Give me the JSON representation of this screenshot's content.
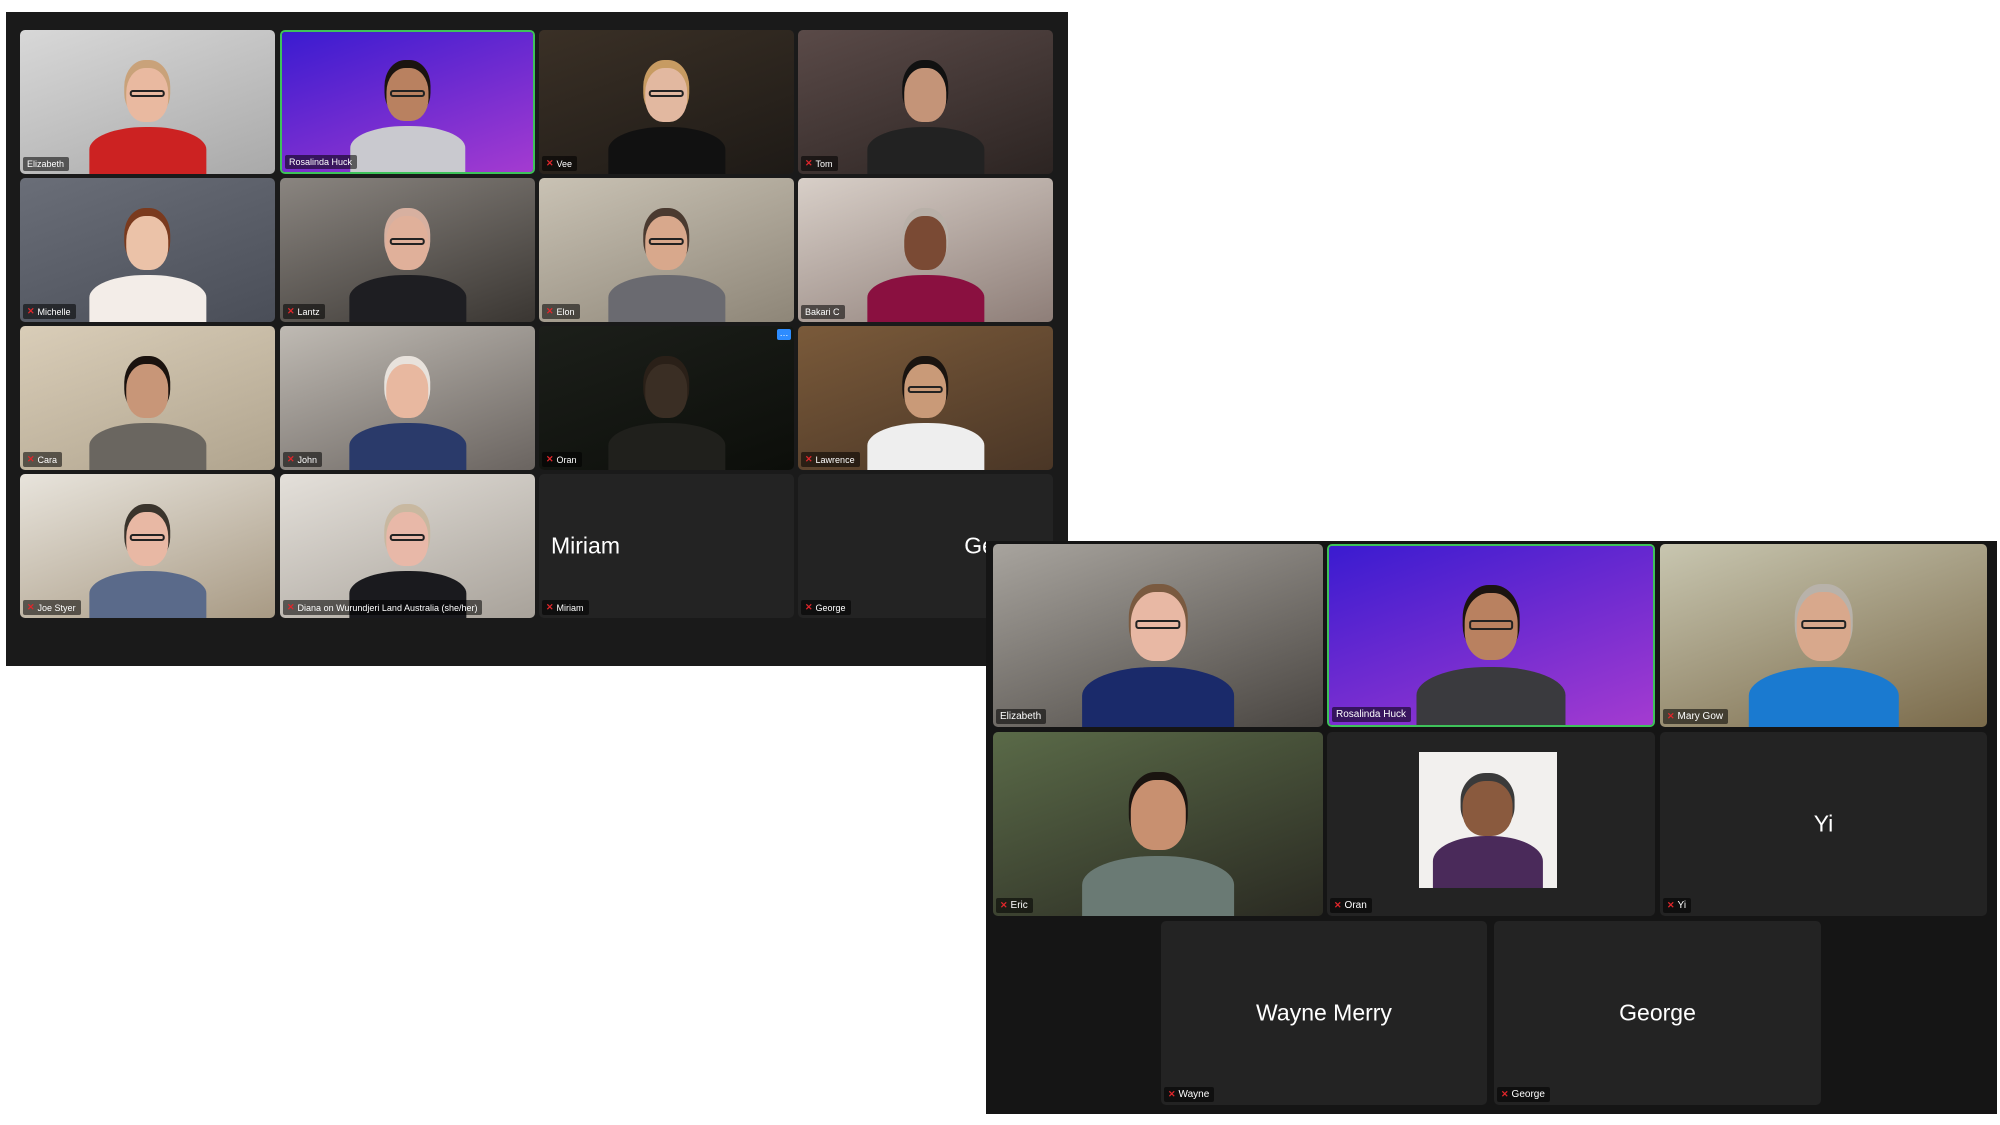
{
  "colors": {
    "speaking_border": "#3ec25a",
    "muted_icon": "#e0262b",
    "tile_bg": "#232323"
  },
  "gallery_1": {
    "tiles": [
      {
        "name": "Elizabeth",
        "type": "video",
        "muted": false,
        "speaking": false,
        "bg": [
          "#d8d8d8",
          "#a9a9a9"
        ],
        "skin": "#e9b9a0",
        "shirt": "#cc2222",
        "hair": "#c9a27a",
        "glasses": true
      },
      {
        "name": "Rosalinda Huck",
        "type": "video",
        "muted": false,
        "speaking": true,
        "bg": [
          "#3a1bd0",
          "#a43bd0"
        ],
        "skin": "#b98160",
        "shirt": "#c9c9cf",
        "hair": "#1b1410",
        "glasses": true
      },
      {
        "name": "Vee",
        "type": "video",
        "muted": true,
        "speaking": false,
        "bg": [
          "#3a3026",
          "#1e1a16"
        ],
        "skin": "#e2b8a0",
        "shirt": "#111111",
        "hair": "#c79b62",
        "glasses": true
      },
      {
        "name": "Tom",
        "type": "video",
        "muted": true,
        "speaking": false,
        "bg": [
          "#5a4a48",
          "#2c2422"
        ],
        "skin": "#c49478",
        "shirt": "#222222",
        "hair": "#111111",
        "glasses": false
      },
      {
        "name": "Michelle",
        "type": "video",
        "muted": true,
        "speaking": false,
        "bg": [
          "#6a6e78",
          "#4a4e58"
        ],
        "skin": "#ebc2a8",
        "shirt": "#f3ede8",
        "hair": "#7a3a1e",
        "glasses": false
      },
      {
        "name": "Lantz",
        "type": "video",
        "muted": true,
        "speaking": false,
        "bg": [
          "#8a8580",
          "#3a3632"
        ],
        "skin": "#e0b09a",
        "shirt": "#1e1e22",
        "hair": "#d7b0a0",
        "glasses": true
      },
      {
        "name": "Elon",
        "type": "video",
        "muted": true,
        "speaking": false,
        "bg": [
          "#c9c2b4",
          "#8e8678"
        ],
        "skin": "#d8a88c",
        "shirt": "#6a6a70",
        "hair": "#4a3a30",
        "glasses": true
      },
      {
        "name": "Bakari C",
        "type": "video",
        "muted": false,
        "speaking": false,
        "bg": [
          "#d8cfc8",
          "#8e7e78"
        ],
        "skin": "#7a4a34",
        "shirt": "#8a1040",
        "hair": "#b8b0a8",
        "glasses": false
      },
      {
        "name": "Cara",
        "type": "video",
        "muted": true,
        "speaking": false,
        "bg": [
          "#d9cdb8",
          "#b0a48e"
        ],
        "skin": "#c89678",
        "shirt": "#6a6660",
        "hair": "#1a120e",
        "glasses": false
      },
      {
        "name": "John",
        "type": "video",
        "muted": true,
        "speaking": false,
        "bg": [
          "#bfbab3",
          "#6a6460"
        ],
        "skin": "#e8b8a0",
        "shirt": "#2a3a6a",
        "hair": "#e8e2dc",
        "glasses": false
      },
      {
        "name": "Oran",
        "type": "video",
        "muted": true,
        "speaking": false,
        "bg": [
          "#1c1f1a",
          "#0c0e0a"
        ],
        "skin": "#3a2e24",
        "shirt": "#20201c",
        "hair": "#2a2018",
        "glasses": false,
        "more_button": true
      },
      {
        "name": "Lawrence",
        "type": "video",
        "muted": true,
        "speaking": false,
        "bg": [
          "#7a5a3a",
          "#4a3626"
        ],
        "skin": "#c99a78",
        "shirt": "#eeeeee",
        "hair": "#1a1410",
        "glasses": true
      },
      {
        "name": "Joe Styer",
        "type": "video",
        "muted": true,
        "speaking": false,
        "bg": [
          "#e8e4dc",
          "#a89a84"
        ],
        "skin": "#e8b8a4",
        "shirt": "#5a6a8a",
        "hair": "#3a342c",
        "glasses": true
      },
      {
        "name": "Diana on Wurundjeri Land Australia (she/her)",
        "type": "video",
        "muted": true,
        "speaking": false,
        "bg": [
          "#e4e0da",
          "#a8a29a"
        ],
        "skin": "#e8b8a8",
        "shirt": "#1a1a1e",
        "hair": "#c8b8a0",
        "glasses": true
      },
      {
        "name": "Miriam",
        "display": "Miriam",
        "type": "name",
        "align": "left",
        "muted": true,
        "speaking": false
      },
      {
        "name": "George",
        "display": "George",
        "type": "name",
        "align": "right",
        "muted": true,
        "speaking": false
      }
    ]
  },
  "gallery_2": {
    "tiles": [
      {
        "name": "Elizabeth",
        "type": "video",
        "muted": false,
        "speaking": false,
        "bg": [
          "#a8a49e",
          "#4a4642"
        ],
        "skin": "#e8b8a4",
        "shirt": "#1a2a6a",
        "hair": "#7a5a40",
        "glasses": true
      },
      {
        "name": "Rosalinda Huck",
        "type": "video",
        "muted": false,
        "speaking": true,
        "bg": [
          "#3a1bd0",
          "#a43bd0"
        ],
        "skin": "#b98160",
        "shirt": "#3a3a3e",
        "hair": "#1b1410",
        "glasses": true
      },
      {
        "name": "Mary Gow",
        "type": "video",
        "muted": true,
        "speaking": false,
        "bg": [
          "#c8c6b0",
          "#7a6a4a"
        ],
        "skin": "#d8a88c",
        "shirt": "#1a7ad0",
        "hair": "#b8b2aa",
        "glasses": true
      },
      {
        "name": "Eric",
        "type": "video",
        "muted": true,
        "speaking": false,
        "bg": [
          "#5a6a48",
          "#2a2a22"
        ],
        "skin": "#c89070",
        "shirt": "#6a7a74",
        "hair": "#1a1410",
        "glasses": false
      },
      {
        "name": "Oran",
        "type": "photo",
        "muted": true,
        "speaking": false,
        "skin": "#8a5a3e",
        "shirt": "#4a2a5a",
        "hair": "#3a3a3a"
      },
      {
        "name": "Yi",
        "display": "Yi",
        "type": "name",
        "align": "center",
        "muted": true,
        "speaking": false
      },
      {
        "name": "Wayne",
        "display": "Wayne Merry",
        "type": "name",
        "align": "center",
        "muted": true,
        "speaking": false
      },
      {
        "name": "George",
        "display": "George",
        "type": "name",
        "align": "center",
        "muted": true,
        "speaking": false
      }
    ]
  }
}
